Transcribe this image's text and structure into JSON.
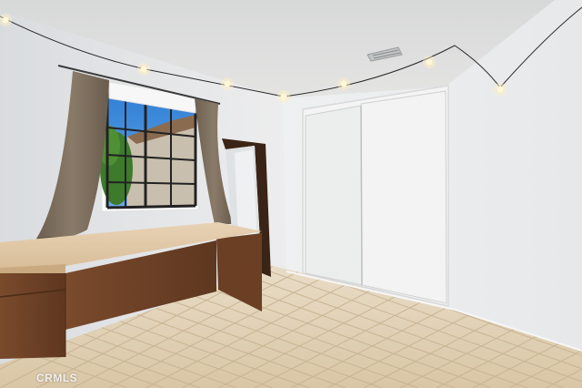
{
  "photo": {
    "subject": "empty-bedroom-interior"
  },
  "watermark": {
    "text": "CRMLS"
  }
}
